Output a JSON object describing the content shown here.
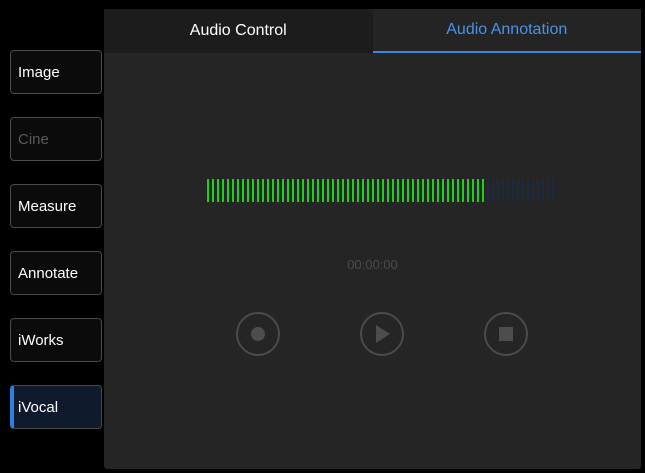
{
  "sidebar": {
    "items": [
      {
        "label": "Image",
        "state": "normal"
      },
      {
        "label": "Cine",
        "state": "disabled"
      },
      {
        "label": "Measure",
        "state": "normal"
      },
      {
        "label": "Annotate",
        "state": "normal"
      },
      {
        "label": "iWorks",
        "state": "normal"
      },
      {
        "label": "iVocal",
        "state": "active"
      }
    ]
  },
  "tabs": [
    {
      "label": "Audio Control",
      "selected": false
    },
    {
      "label": "Audio Annotation",
      "selected": true
    }
  ],
  "level_meter": {
    "level": 0.8,
    "active_color": "#1fd11c",
    "inactive_color": "#1c2a3e"
  },
  "timer": {
    "value": "00:00:00"
  },
  "controls": [
    {
      "icon": "record-icon"
    },
    {
      "icon": "play-icon"
    },
    {
      "icon": "stop-icon"
    }
  ],
  "colors": {
    "accent": "#3a86e0",
    "tab_active_text": "#4a93e8"
  }
}
